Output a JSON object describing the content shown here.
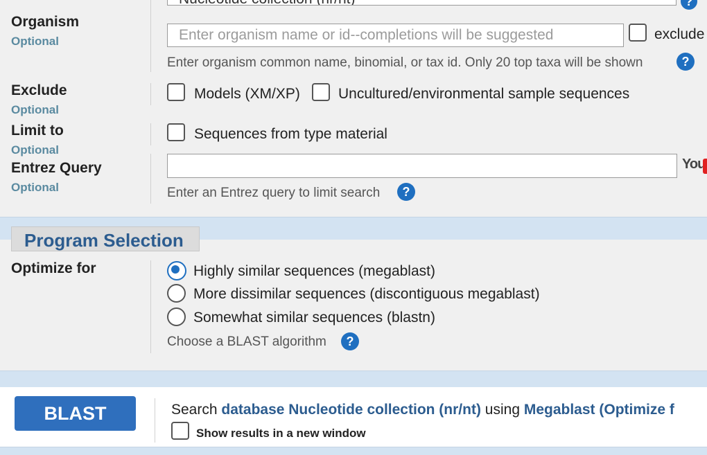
{
  "top_field": {
    "value": "Nucleotide collection (nr/nt)"
  },
  "organism": {
    "label": "Organism",
    "optional": "Optional",
    "placeholder": "Enter organism name or id--completions will be suggested",
    "exclude_label": "exclude",
    "help": "Enter organism common name, binomial, or tax id. Only 20 top taxa will be shown"
  },
  "exclude": {
    "label": "Exclude",
    "optional": "Optional",
    "models_label": "Models (XM/XP)",
    "uncultured_label": "Uncultured/environmental sample sequences"
  },
  "limit_to": {
    "label": "Limit to",
    "optional": "Optional",
    "type_material_label": "Sequences from type material"
  },
  "entrez": {
    "label": "Entrez Query",
    "optional": "Optional",
    "value": "",
    "youtube_label": "You",
    "help": "Enter an Entrez query to limit search"
  },
  "program": {
    "title": "Program Selection",
    "optimize_label": "Optimize for",
    "options": [
      {
        "label": "Highly similar sequences (megablast)",
        "selected": true
      },
      {
        "label": "More dissimilar sequences (discontiguous megablast)",
        "selected": false
      },
      {
        "label": "Somewhat similar sequences (blastn)",
        "selected": false
      }
    ],
    "help": "Choose a BLAST algorithm"
  },
  "submit": {
    "button_label": "BLAST",
    "search_prefix": "Search",
    "database_link": "database Nucleotide collection (nr/nt)",
    "using_text": "using",
    "program_link": "Megablast (Optimize f",
    "new_window_label": "Show results in a new window"
  },
  "help_icon": "?",
  "colors": {
    "accent": "#1f6fc0",
    "band": "#d3e3f2",
    "link": "#2c5c8f",
    "button": "#2f6fbd"
  }
}
